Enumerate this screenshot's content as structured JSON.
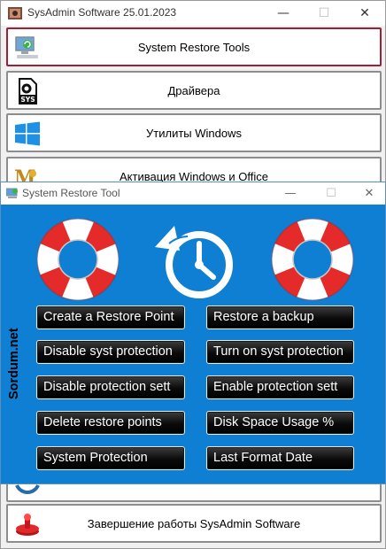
{
  "back_window": {
    "title": "SysAdmin Software 25.01.2023",
    "controls": {
      "minimize": "—",
      "maximize": "☐",
      "close": "✕"
    },
    "buttons": [
      {
        "label": "System Restore Tools",
        "icon": "monitor-restore-icon",
        "active": true
      },
      {
        "label": "Драйвера",
        "icon": "sys-file-icon"
      },
      {
        "label": "Утилиты Windows",
        "icon": "windows-logo-icon"
      },
      {
        "label": "Активация Windows и Office",
        "icon": "activation-icon"
      },
      {
        "label": "Завершение работы SysAdmin Software",
        "icon": "power-icon"
      }
    ]
  },
  "front_window": {
    "title": "System Restore Tool",
    "controls": {
      "minimize": "—",
      "maximize": "☐",
      "close": "✕"
    },
    "watermark": "Sordum.net",
    "buttons_left": [
      "Create a Restore Point",
      "Disable syst protection",
      "Disable protection sett",
      "Delete restore points",
      "System Protection"
    ],
    "buttons_right": [
      "Restore a backup",
      "Turn on syst protection",
      "Enable protection sett",
      "Disk Space Usage %",
      "Last Format Date"
    ],
    "colors": {
      "background": "#0e7fd3",
      "ring_red": "#e52a2a",
      "button_bg": "#000000"
    }
  }
}
